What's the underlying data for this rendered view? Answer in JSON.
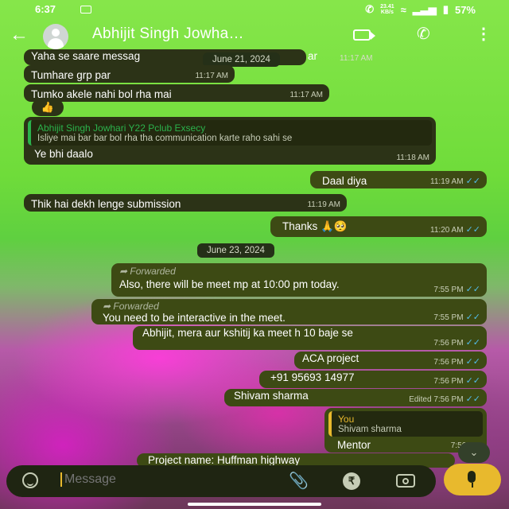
{
  "status": {
    "time": "6:37",
    "net_speed_top": "23.41",
    "net_speed_bottom": "KB/s",
    "battery": "57%"
  },
  "header": {
    "back_icon": "arrow-left-icon",
    "contact_name": "Abhijit Singh Jowha…",
    "video_icon": "video-call-icon",
    "call_icon": "phone-icon",
    "menu_icon": "more-vert-icon"
  },
  "messages": {
    "m1": {
      "text": "Yaha se saare messag",
      "tail": "ar",
      "time": "11:17 AM"
    },
    "floating_date": "June 21, 2024",
    "m2": {
      "text": "Tumhare grp par",
      "time": "11:17 AM"
    },
    "m3": {
      "text": "Tumko akele nahi bol rha mai",
      "time": "11:17 AM"
    },
    "m3_reaction": "👍",
    "m4": {
      "quote_name": "Abhijit Singh Jowhari Y22 Pclub Exsecy",
      "quote_text": "Isliye mai bar bar bol rha tha communication karte raho sahi se",
      "text": "Ye bhi daalo",
      "time": "11:18 AM"
    },
    "m5": {
      "text": "Daal diya",
      "time": "11:19 AM",
      "ticks": "✓✓"
    },
    "m6": {
      "text": "Thik hai dekh lenge submission",
      "time": "11:19 AM"
    },
    "m7": {
      "text": "Thanks 🙏🥺",
      "time": "11:20 AM",
      "ticks": "✓✓"
    },
    "date2": "June 23, 2024",
    "m8": {
      "fwd": "Forwarded",
      "text": "Also, there will be meet mp at 10:00 pm today.",
      "time": "7:55 PM",
      "ticks": "✓✓"
    },
    "m9": {
      "fwd": "Forwarded",
      "text": "You need to be interactive in the meet.",
      "time": "7:55 PM",
      "ticks": "✓✓"
    },
    "m10": {
      "text": "Abhijit, mera aur kshitij ka meet h 10 baje se",
      "time": "7:56 PM",
      "ticks": "✓✓"
    },
    "m11": {
      "text": "ACA project",
      "time": "7:56 PM",
      "ticks": "✓✓"
    },
    "m12": {
      "text": "+91 95693 14977",
      "time": "7:56 PM",
      "ticks": "✓✓"
    },
    "m13": {
      "text": "Shivam sharma",
      "time": "Edited 7:56 PM",
      "ticks": "✓✓"
    },
    "m14": {
      "quote_name": "You",
      "quote_text": "Shivam sharma",
      "text": "Mentor",
      "time": "7:56 PM"
    },
    "m15": {
      "text": "Project name:  Huffman highway"
    }
  },
  "composer": {
    "placeholder": "Message",
    "rupee_symbol": "₹"
  },
  "colors": {
    "incoming_bubble": "#2c3317",
    "outgoing_bubble": "#3d4a14",
    "accent": "#e8b92d",
    "read_ticks": "#53bdeb"
  }
}
